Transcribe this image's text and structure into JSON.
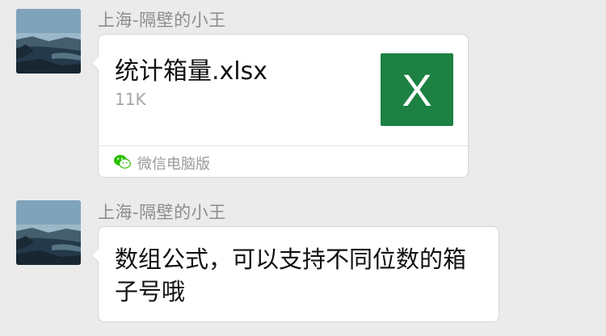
{
  "messages": [
    {
      "sender": "上海-隔壁的小王",
      "type": "file",
      "file": {
        "name": "统计箱量.xlsx",
        "size": "11K",
        "icon_letter": "X",
        "icon_color": "#1d8143",
        "icon": "excel-file-icon"
      },
      "source_label": "微信电脑版",
      "source_icon": "wechat-icon"
    },
    {
      "sender": "上海-隔壁的小王",
      "type": "text",
      "text": "数组公式，可以支持不同位数的箱子号哦"
    }
  ],
  "colors": {
    "background": "#ebebeb",
    "bubble": "#ffffff",
    "sender_text": "#8c8c8c",
    "wechat_green": "#2dc100"
  }
}
